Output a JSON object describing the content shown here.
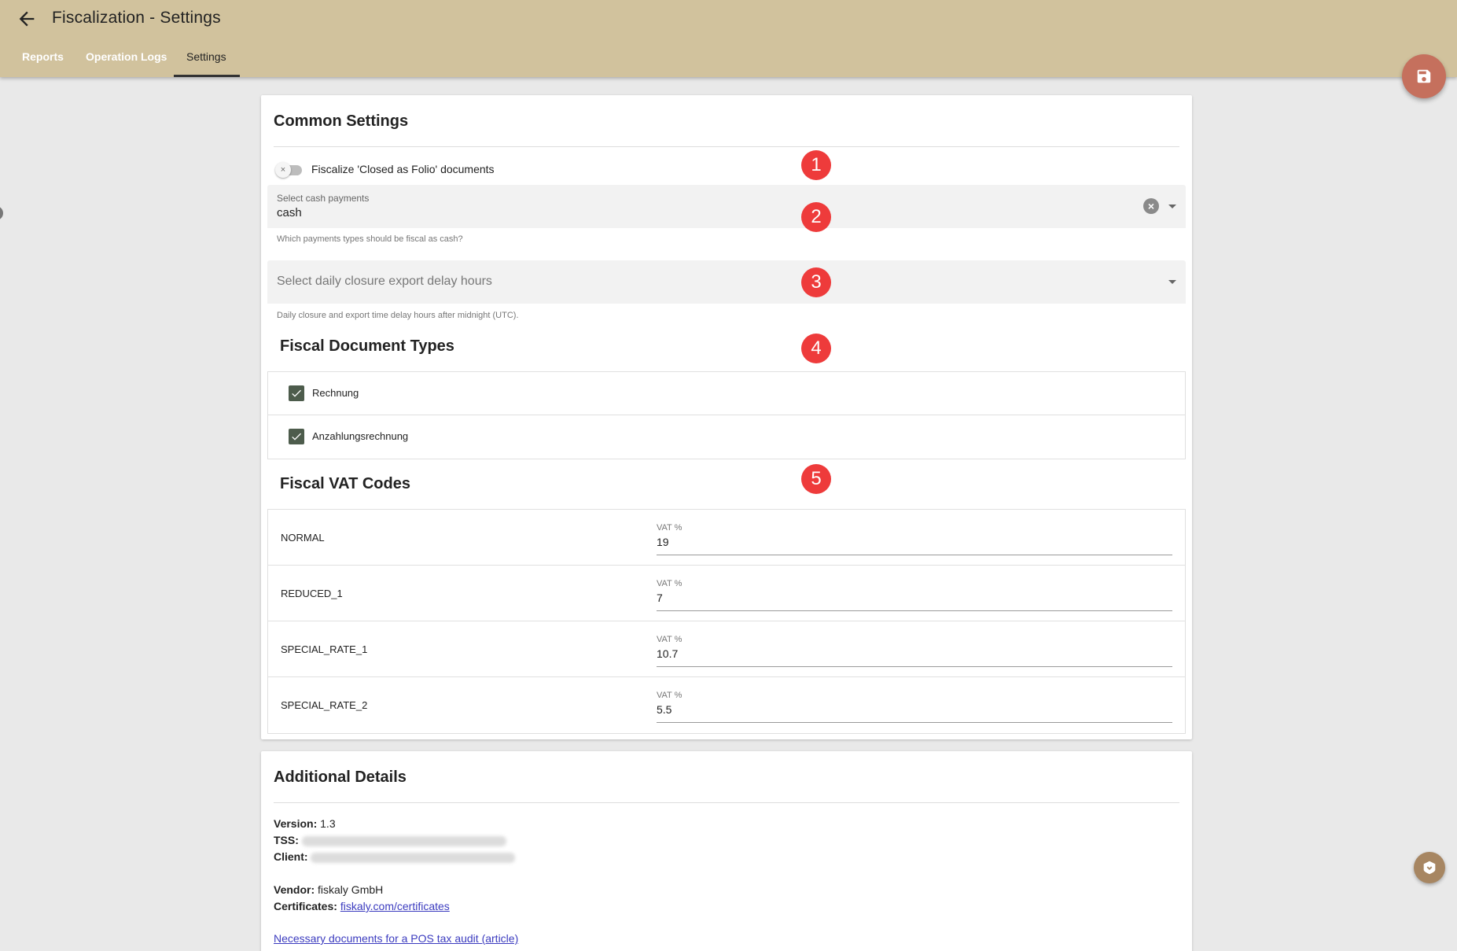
{
  "header": {
    "title": "Fiscalization - Settings",
    "tabs": [
      {
        "label": "Reports"
      },
      {
        "label": "Operation Logs"
      },
      {
        "label": "Settings"
      }
    ],
    "active_tab": "Settings"
  },
  "common_settings": {
    "title": "Common Settings",
    "toggle_label": "Fiscalize 'Closed as Folio' documents",
    "toggle_on": false,
    "cash_payments": {
      "label": "Select cash payments",
      "value": "cash",
      "hint": "Which payments types should be fiscal as cash?"
    },
    "delay_hours": {
      "placeholder": "Select daily closure export delay hours",
      "hint": "Daily closure and export time delay hours after midnight (UTC)."
    }
  },
  "fiscal_document_types": {
    "title": "Fiscal Document Types",
    "items": [
      {
        "label": "Rechnung",
        "checked": true
      },
      {
        "label": "Anzahlungsrechnung",
        "checked": true
      }
    ]
  },
  "fiscal_vat_codes": {
    "title": "Fiscal VAT Codes",
    "rows": [
      {
        "name": "NORMAL",
        "field_label": "VAT %",
        "value": "19"
      },
      {
        "name": "REDUCED_1",
        "field_label": "VAT %",
        "value": "7"
      },
      {
        "name": "SPECIAL_RATE_1",
        "field_label": "VAT %",
        "value": "10.7"
      },
      {
        "name": "SPECIAL_RATE_2",
        "field_label": "VAT %",
        "value": "5.5"
      }
    ]
  },
  "badges": [
    "1",
    "2",
    "3",
    "4",
    "5"
  ],
  "additional_details": {
    "title": "Additional Details",
    "version_label": "Version:",
    "version_value": "1.3",
    "tss_label": "TSS:",
    "client_label": "Client:",
    "vendor_label": "Vendor:",
    "vendor_value": "fiskaly GmbH",
    "certificates_label": "Certificates:",
    "certificates_link": "fiskaly.com/certificates",
    "article_link": "Necessary documents for a POS tax audit (article)"
  },
  "colors": {
    "header_bg": "#d1c29d",
    "fab": "#c5705d",
    "badge": "#ee3b3b",
    "checkbox": "#4d5c4c"
  },
  "icons": [
    "back-arrow-icon",
    "save-icon",
    "clear-icon",
    "dropdown-arrow-icon",
    "check-icon",
    "help-book-icon"
  ]
}
